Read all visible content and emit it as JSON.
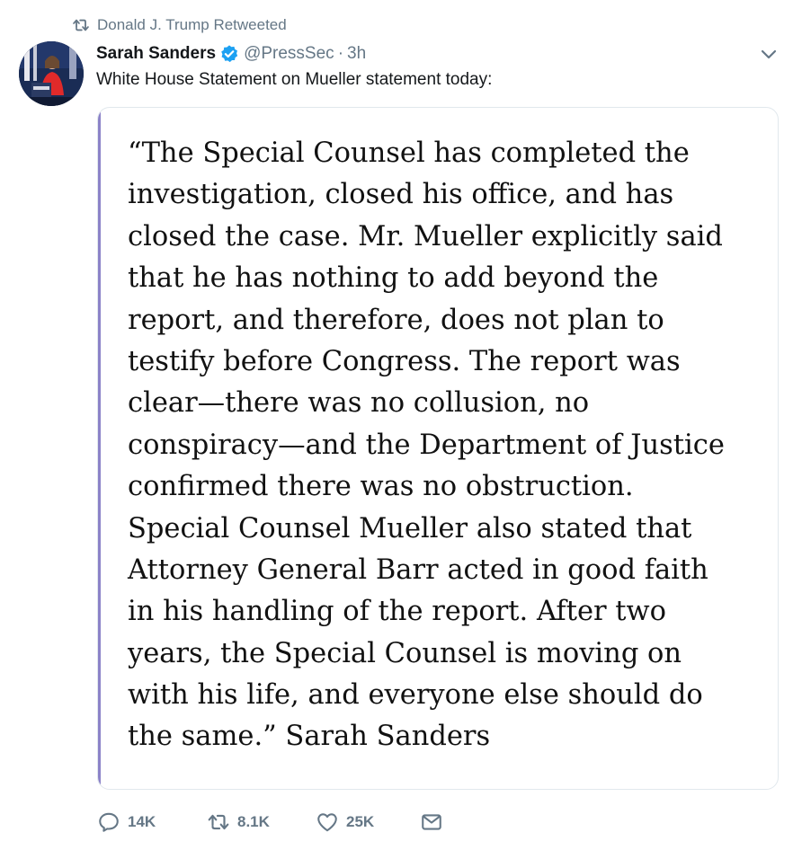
{
  "retweet_context": {
    "icon": "retweet-icon",
    "text": "Donald J. Trump Retweeted"
  },
  "author": {
    "display_name": "Sarah Sanders",
    "verified_icon": "verified-badge-icon",
    "handle": "@PressSec",
    "separator": "·",
    "time": "3h"
  },
  "menu": {
    "icon": "chevron-down-icon"
  },
  "tweet": {
    "text": "White House Statement on Mueller statement today:"
  },
  "statement": {
    "accent_color": "#8c83c8",
    "lines": [
      "“The Special Counsel has completed the",
      "investigation, closed his office, and has",
      "closed the case. Mr. Mueller explicitly said",
      "that he has nothing to add beyond the",
      "report, and therefore, does not plan to",
      "testify before Congress. The report was",
      "clear—there was no collusion, no",
      "conspiracy—and the Department of Justice",
      "confirmed there was no obstruction.",
      "Special Counsel Mueller also stated that",
      "Attorney General Barr acted in good faith",
      "in his handling of the report. After two",
      "years, the Special Counsel is moving on",
      "with his life, and everyone else should do",
      "the same.” Sarah Sanders"
    ]
  },
  "actions": {
    "reply": {
      "icon": "reply-icon",
      "count": "14K"
    },
    "retweet": {
      "icon": "retweet-icon",
      "count": "8.1K"
    },
    "like": {
      "icon": "heart-icon",
      "count": "25K"
    },
    "message": {
      "icon": "envelope-icon"
    }
  },
  "colors": {
    "text_primary": "#14171a",
    "text_secondary": "#657786",
    "verified_blue": "#1da1f2",
    "card_border": "#e1e8ed"
  }
}
